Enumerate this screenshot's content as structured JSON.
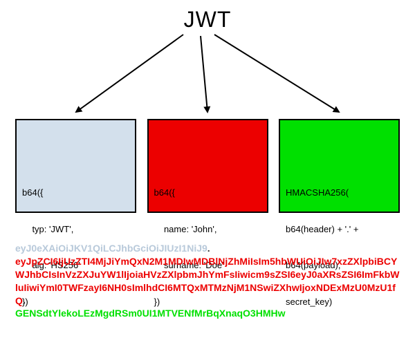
{
  "title": "JWT",
  "boxes": {
    "header": {
      "l1": "b64({",
      "l2": "    typ: 'JWT',",
      "l3": "    alg: 'HS256'",
      "l4": "})"
    },
    "payload": {
      "l1": "b64({",
      "l2": "    name: 'John',",
      "l3": "    surname: 'Doe'",
      "l4": "})"
    },
    "signature": {
      "l1": "HMACSHA256(",
      "l2": "b64(header) + '.' +",
      "l3": "b64(payload),",
      "l4": "secret_key)"
    }
  },
  "token": {
    "header": "eyJ0eXAiOiJKV1QiLCJhbGciOiJIUzI1NiJ9",
    "dot": ".",
    "payload": "eyJpZCI6IjUzZTI4MjJiYmQxN2M1MDIwMDBlNjZhMiIsIm5hbWUiOiJIw7xzZXlpbiBCYWJhbCIsInVzZXJuYW1lIjoiaHVzZXlpbmJhYmFsIiwicm9sZSI6eyJ0aXRsZSI6ImFkbWluIiwiYmI0TWFzayI6NH0sImlhdCI6MTQxMTMzNjM1NSwiZXhwIjoxNDExMzU0MzU1fQ",
    "signature": "GENSdtYlekoLEzMgdRSm0UI1MTVENfMrBqXnaqO3HMHw"
  }
}
